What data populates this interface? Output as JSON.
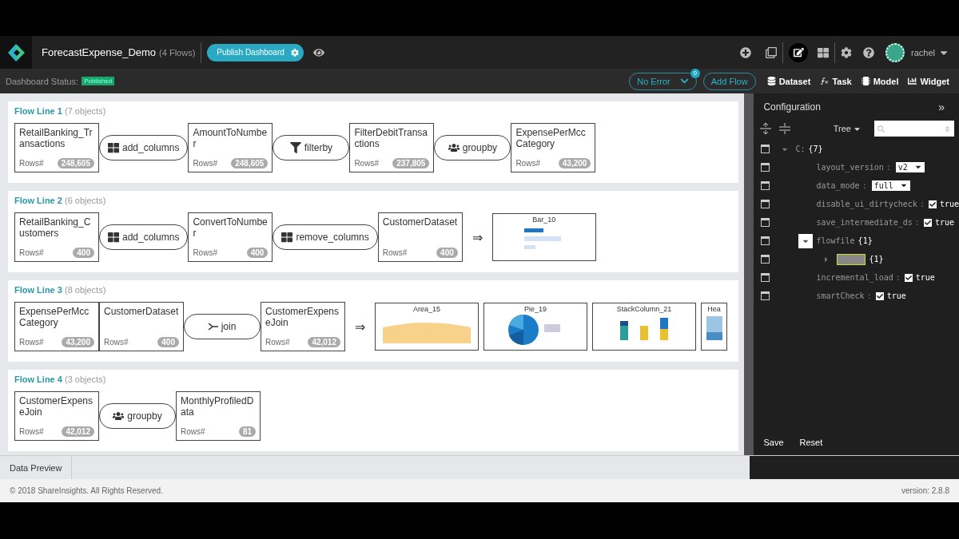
{
  "header": {
    "title": "ForecastExpense_Demo",
    "flow_count": "(4 Flows)",
    "publish_button": "Publish Dashboard",
    "user": "rachel"
  },
  "status_bar": {
    "label": "Dashboard Status:",
    "status": "Published",
    "error_filter": "No Error",
    "error_count": "0",
    "add_flow": "Add Flow"
  },
  "panel_tabs": [
    {
      "label": "Dataset",
      "kind": "dataset"
    },
    {
      "label": "Task",
      "kind": "task"
    },
    {
      "label": "Model",
      "kind": "model"
    },
    {
      "label": "Widget",
      "kind": "widget"
    }
  ],
  "flow_lines": [
    {
      "title": "Flow Line 1",
      "count": "(7 objects)",
      "items": [
        {
          "kind": "dataset",
          "name": "RetailBanking_Transactions",
          "rows_label": "Rows#",
          "rows": "248,605"
        },
        {
          "kind": "columns",
          "label": "add_columns"
        },
        {
          "kind": "dataset",
          "name": "AmountToNumber",
          "rows_label": "Rows#",
          "rows": "248,605"
        },
        {
          "kind": "filter",
          "label": "filterby"
        },
        {
          "kind": "dataset",
          "name": "FilterDebitTransactions",
          "rows_label": "Rows#",
          "rows": "237,805"
        },
        {
          "kind": "group",
          "label": "groupby"
        },
        {
          "kind": "dataset",
          "name": "ExpensePerMccCategory",
          "rows_label": "Rows#",
          "rows": "43,200"
        }
      ]
    },
    {
      "title": "Flow Line 2",
      "count": "(6 objects)",
      "items": [
        {
          "kind": "dataset",
          "name": "RetailBanking_Customers",
          "rows_label": "Rows#",
          "rows": "400"
        },
        {
          "kind": "columns",
          "label": "add_columns"
        },
        {
          "kind": "dataset",
          "name": "ConvertToNumber",
          "rows_label": "Rows#",
          "rows": "400"
        },
        {
          "kind": "columns",
          "label": "remove_columns"
        },
        {
          "kind": "dataset",
          "name": "CustomerDataset",
          "rows_label": "Rows#",
          "rows": "400"
        },
        {
          "kind": "arrow",
          "label": "⇒"
        },
        {
          "kind": "bar-chart",
          "title": "Bar_10"
        }
      ]
    },
    {
      "title": "Flow Line 3",
      "count": "(8 objects)",
      "items": [
        {
          "kind": "dataset",
          "name": "ExpensePerMccCategory",
          "rows_label": "Rows#",
          "rows": "43,200"
        },
        {
          "kind": "dataset",
          "name": "CustomerDataset",
          "rows_label": "Rows#",
          "rows": "400"
        },
        {
          "kind": "join",
          "label": "join"
        },
        {
          "kind": "dataset",
          "name": "CustomerExpenseJoin",
          "rows_label": "Rows#",
          "rows": "42,012"
        },
        {
          "kind": "arrow",
          "label": "⇒"
        },
        {
          "kind": "area-chart",
          "title": "Area_15"
        },
        {
          "kind": "pie-chart",
          "title": "Pie_19"
        },
        {
          "kind": "stack-chart",
          "title": "StackColumn_21"
        },
        {
          "kind": "heat-chart",
          "title": "Hea"
        }
      ]
    },
    {
      "title": "Flow Line 4",
      "count": "(3 objects)",
      "items": [
        {
          "kind": "dataset",
          "name": "CustomerExpenseJoin",
          "rows_label": "Rows#",
          "rows": "42,012"
        },
        {
          "kind": "group",
          "label": "groupby"
        },
        {
          "kind": "dataset",
          "name": "MonthlyProfiledData",
          "rows_label": "Rows#",
          "rows": "81"
        }
      ]
    }
  ],
  "bottom_tab": "Data Preview",
  "configuration": {
    "title": "Configuration",
    "collapse": "»",
    "view_mode": "Tree",
    "tree": [
      {
        "kind": "object",
        "key": "C:",
        "count": "{7}",
        "expanded": true,
        "boxed": false,
        "children": [
          {
            "kind": "select",
            "key": "layout_version",
            "separator": ":",
            "value": "v2"
          },
          {
            "kind": "select",
            "key": "data_mode",
            "separator": ":",
            "value": "full"
          },
          {
            "kind": "checkbox",
            "key": "disable_ui_dirtycheck",
            "separator": ":",
            "checked": true,
            "value": "true"
          },
          {
            "kind": "checkbox",
            "key": "save_intermediate_ds",
            "separator": ":",
            "checked": true,
            "value": "true"
          },
          {
            "kind": "object",
            "key": "flowfile",
            "count": "{1}",
            "expanded": true,
            "boxed": true,
            "children": [
              {
                "kind": "object",
                "count": "{1}",
                "expanded": false,
                "boxed": false,
                "highlighted": true
              }
            ]
          },
          {
            "kind": "checkbox",
            "key": "incremental_load",
            "separator": ":",
            "checked": true,
            "value": "true"
          },
          {
            "kind": "checkbox",
            "key": "smartCheck",
            "separator": ":",
            "checked": true,
            "value": "true"
          }
        ]
      }
    ],
    "buttons": [
      "Save",
      "Reset"
    ]
  },
  "footer": {
    "copyright": "© 2018 ShareInsights. All Rights Reserved.",
    "version": "version: 2.8.8"
  }
}
